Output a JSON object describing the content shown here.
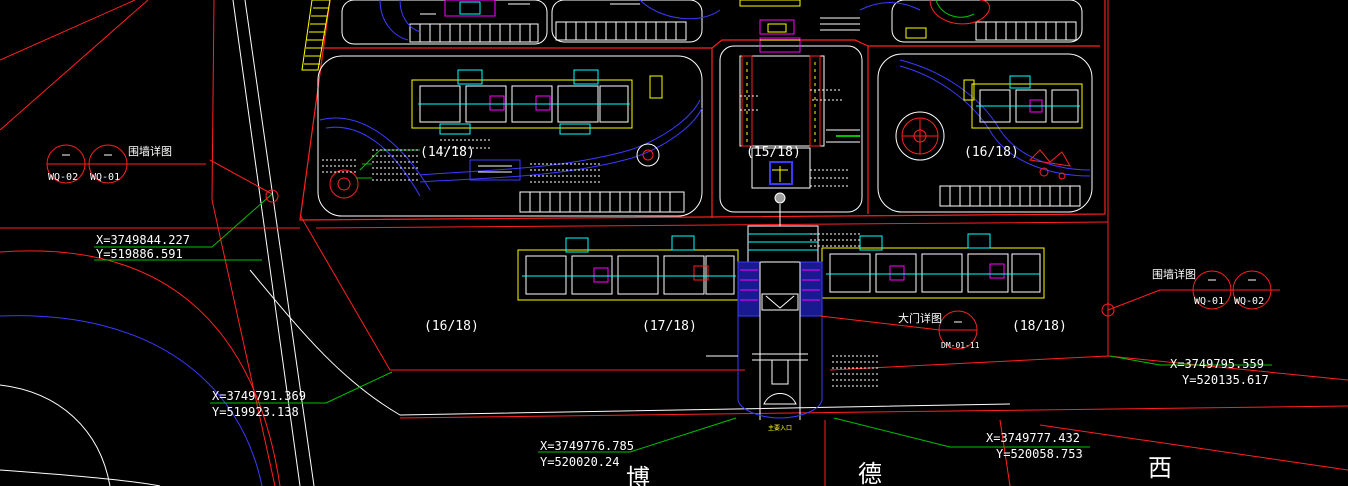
{
  "colors": {
    "background": "#000000",
    "red": "#ff2020",
    "white": "#ffffff",
    "green": "#00c000",
    "blue": "#3a3aff",
    "yellow": "#ffff00",
    "cyan": "#00ffff",
    "magenta": "#ff00ff"
  },
  "zones": {
    "z14": "(14/18)",
    "z15": "(15/18)",
    "z16_upper": "(16/18)",
    "z16_lower": "(16/18)",
    "z17": "(17/18)",
    "z18": "(18/18)"
  },
  "wall_detail": {
    "left_label": "围墙详图",
    "left_tag1": "WQ-02",
    "left_tag2": "WQ-01",
    "right_label": "围墙详图",
    "right_tag1": "WQ-01",
    "right_tag2": "WQ-02"
  },
  "gate_detail": {
    "label": "大门详图",
    "tag": "DM-01-11"
  },
  "coordinates": {
    "c1_x": "X=3749844.227",
    "c1_y": "Y=519886.591",
    "c2_x": "X=3749791.369",
    "c2_y": "Y=519923.138",
    "c3_x": "X=3749776.785",
    "c3_y": "Y=520020.24",
    "c4_x": "X=3749777.432",
    "c4_y": "Y=520058.753",
    "c5_x": "X=3749795.559",
    "c5_y": "Y=520135.617"
  },
  "road_name": {
    "char1": "博",
    "char2": "德",
    "char3": "西"
  },
  "entrance_label": "主要入口"
}
